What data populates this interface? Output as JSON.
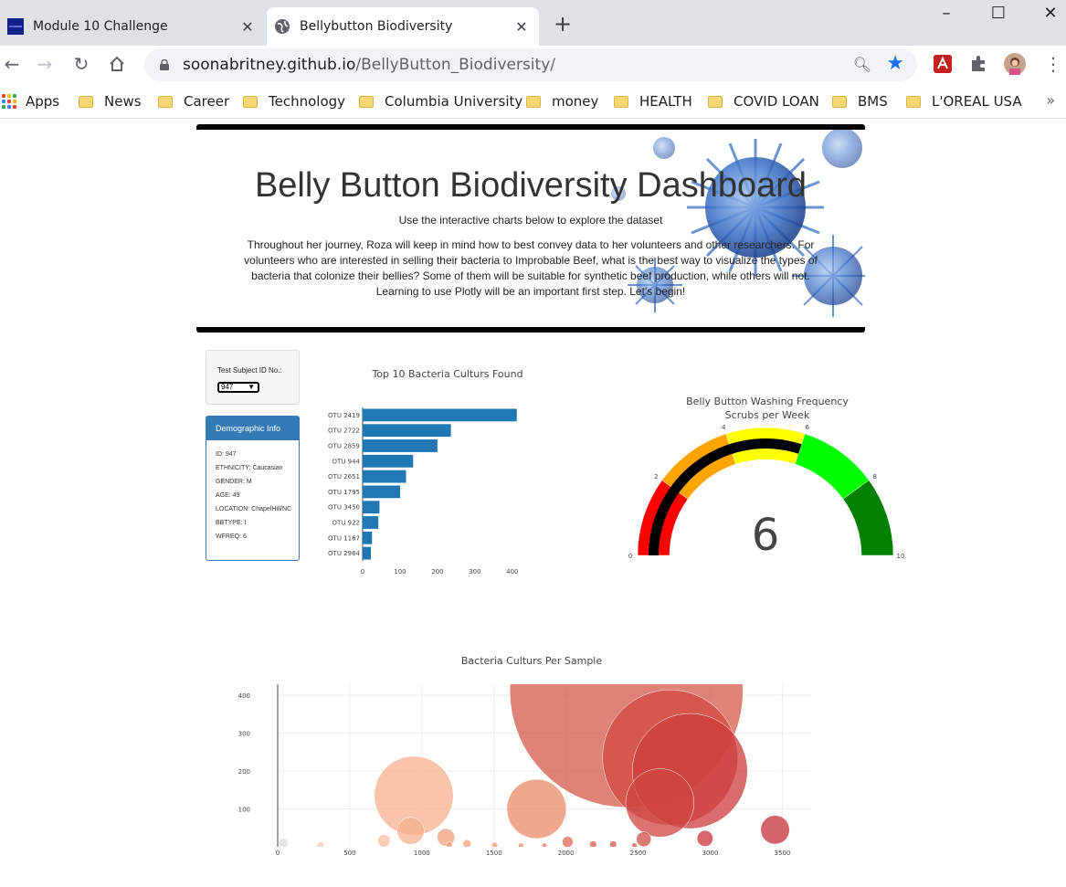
{
  "browser": {
    "tabs": [
      {
        "title": "Module 10 Challenge",
        "active": false
      },
      {
        "title": "Bellybutton Biodiversity",
        "active": true
      }
    ],
    "url_host": "soonabritney.github.io",
    "url_path": "/BellyButton_Biodiversity/",
    "bookmarks": [
      "Apps",
      "News",
      "Career",
      "Technology",
      "Columbia University",
      "money",
      "HEALTH",
      "COVID LOAN",
      "BMS",
      "L'OREAL USA"
    ]
  },
  "header": {
    "title": "Belly Button Biodiversity Dashboard",
    "subtitle": "Use the interactive charts below to explore the dataset",
    "description": "Throughout her journey, Roza will keep in mind how to best convey data to her volunteers and other researchers. For volunteers who are interested in selling their bacteria to Improbable Beef, what is the best way to visualize the types of bacteria that colonize their bellies? Some of them will be suitable for synthetic beef production, while others will not. Learning to use Plotly will be an important first step. Let's begin!"
  },
  "selector": {
    "label": "Test Subject ID No.:",
    "value": "947"
  },
  "demographics": {
    "heading": "Demographic Info",
    "rows": [
      "ID: 947",
      "ETHNICITY: Caucasian",
      "GENDER: M",
      "AGE: 49",
      "LOCATION: ChapelHill/NC",
      "BBTYPE: I",
      "WFREQ: 6"
    ]
  },
  "chart_data": [
    {
      "type": "bar",
      "orientation": "horizontal",
      "title": "Top 10 Bacteria Culturs Found",
      "categories": [
        "OTU 2419",
        "OTU 2722",
        "OTU 2859",
        "OTU 944",
        "OTU 2651",
        "OTU 1795",
        "OTU 3450",
        "OTU 922",
        "OTU 1167",
        "OTU 2964"
      ],
      "values": [
        412,
        236,
        200,
        135,
        116,
        100,
        45,
        42,
        25,
        22
      ],
      "xlim": [
        0,
        420
      ],
      "xticks": [
        0,
        100,
        200,
        300,
        400
      ],
      "color": "#1f77b4"
    },
    {
      "type": "gauge",
      "title": "Belly Button Washing Frequency",
      "subtitle": "Scrubs per Week",
      "value": 6,
      "range": [
        0,
        10
      ],
      "ticks": [
        0,
        2,
        4,
        6,
        8,
        10
      ],
      "steps": [
        {
          "range": [
            0,
            2
          ],
          "color": "#ff0000"
        },
        {
          "range": [
            2,
            4
          ],
          "color": "#ffa500"
        },
        {
          "range": [
            4,
            6
          ],
          "color": "#ffff00"
        },
        {
          "range": [
            6,
            8
          ],
          "color": "#00ff00"
        },
        {
          "range": [
            8,
            10
          ],
          "color": "#008000"
        }
      ],
      "bar_color": "#000000"
    },
    {
      "type": "scatter",
      "title": "Bacteria Culturs Per Sample",
      "xlim": [
        0,
        3700
      ],
      "ylim": [
        0,
        410
      ],
      "xticks": [
        0,
        500,
        1000,
        1500,
        2000,
        2500,
        3000,
        3500
      ],
      "yticks": [
        100,
        200,
        300,
        400
      ],
      "points": [
        {
          "x": 2419,
          "y": 412,
          "size": 412,
          "color": "#d4594a"
        },
        {
          "x": 2722,
          "y": 236,
          "size": 236,
          "color": "#d1483f"
        },
        {
          "x": 2859,
          "y": 200,
          "size": 200,
          "color": "#cc3c3c"
        },
        {
          "x": 944,
          "y": 135,
          "size": 135,
          "color": "#f6b08e"
        },
        {
          "x": 2651,
          "y": 116,
          "size": 116,
          "color": "#cf4640"
        },
        {
          "x": 1795,
          "y": 100,
          "size": 100,
          "color": "#ea8a68"
        },
        {
          "x": 3450,
          "y": 45,
          "size": 45,
          "color": "#c6323a"
        },
        {
          "x": 922,
          "y": 42,
          "size": 42,
          "color": "#f6b08e"
        },
        {
          "x": 1167,
          "y": 25,
          "size": 25,
          "color": "#f0a07c"
        },
        {
          "x": 2964,
          "y": 22,
          "size": 22,
          "color": "#c9343c"
        },
        {
          "x": 2539,
          "y": 20,
          "size": 20,
          "color": "#d34d45"
        },
        {
          "x": 737,
          "y": 16,
          "size": 16,
          "color": "#f8bd9e"
        },
        {
          "x": 2011,
          "y": 13,
          "size": 13,
          "color": "#e06a54"
        },
        {
          "x": 40,
          "y": 10,
          "size": 10,
          "color": "#dcdcdc"
        },
        {
          "x": 1313,
          "y": 8,
          "size": 8,
          "color": "#f0a07c"
        },
        {
          "x": 2188,
          "y": 6,
          "size": 6,
          "color": "#d85e4c"
        },
        {
          "x": 2327,
          "y": 6,
          "size": 6,
          "color": "#d5574a"
        },
        {
          "x": 297,
          "y": 5,
          "size": 5,
          "color": "#eecbb8"
        },
        {
          "x": 1505,
          "y": 4,
          "size": 4,
          "color": "#ed9672"
        },
        {
          "x": 1189,
          "y": 5,
          "size": 5,
          "color": "#f0a07c"
        },
        {
          "x": 1688,
          "y": 3,
          "size": 3,
          "color": "#ea8a68"
        },
        {
          "x": 1850,
          "y": 3,
          "size": 3,
          "color": "#e87d60"
        },
        {
          "x": 2474,
          "y": 3,
          "size": 3,
          "color": "#d4574a"
        }
      ]
    }
  ]
}
